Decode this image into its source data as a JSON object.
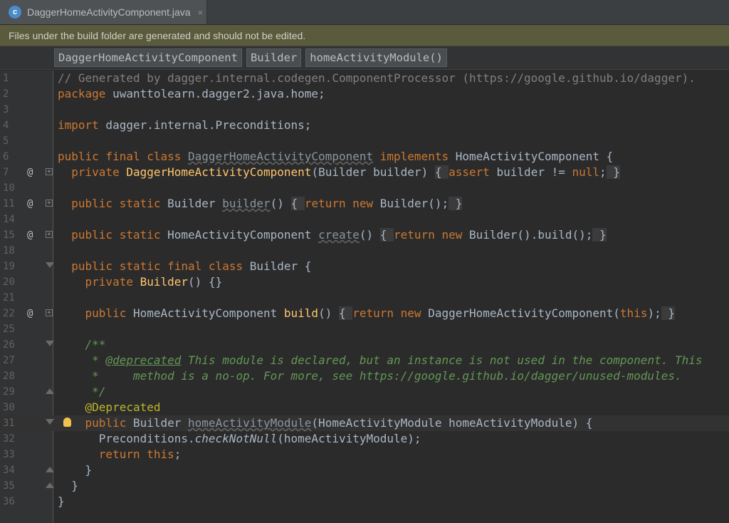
{
  "tab": {
    "title": "DaggerHomeActivityComponent.java",
    "close": "×",
    "icon_letter": "c"
  },
  "banner": {
    "text": "Files under the build folder are generated and should not be edited."
  },
  "breadcrumbs": [
    "DaggerHomeActivityComponent",
    "Builder",
    "homeActivityModule()"
  ],
  "lines": [
    {
      "n": "1",
      "code": "// Generated by dagger.internal.codegen.ComponentProcessor (https://google.github.io/dagger)."
    },
    {
      "n": "2",
      "code": "package uwanttolearn.dagger2.java.home;"
    },
    {
      "n": "3",
      "code": ""
    },
    {
      "n": "4",
      "code": "import dagger.internal.Preconditions;"
    },
    {
      "n": "5",
      "code": ""
    },
    {
      "n": "6",
      "code": "public final class DaggerHomeActivityComponent implements HomeActivityComponent {"
    },
    {
      "n": "7",
      "code": "  private DaggerHomeActivityComponent(Builder builder) { assert builder != null; }"
    },
    {
      "n": "10",
      "code": ""
    },
    {
      "n": "11",
      "code": "  public static Builder builder() { return new Builder(); }"
    },
    {
      "n": "14",
      "code": ""
    },
    {
      "n": "15",
      "code": "  public static HomeActivityComponent create() { return new Builder().build(); }"
    },
    {
      "n": "18",
      "code": ""
    },
    {
      "n": "19",
      "code": "  public static final class Builder {"
    },
    {
      "n": "20",
      "code": "    private Builder() {}"
    },
    {
      "n": "21",
      "code": ""
    },
    {
      "n": "22",
      "code": "    public HomeActivityComponent build() { return new DaggerHomeActivityComponent(this); }"
    },
    {
      "n": "25",
      "code": ""
    },
    {
      "n": "26",
      "code": "    /**"
    },
    {
      "n": "27",
      "code": "     * @deprecated This module is declared, but an instance is not used in the component. This"
    },
    {
      "n": "28",
      "code": "     *     method is a no-op. For more, see https://google.github.io/dagger/unused-modules."
    },
    {
      "n": "29",
      "code": "     */"
    },
    {
      "n": "30",
      "code": "    @Deprecated"
    },
    {
      "n": "31",
      "code": "    public Builder homeActivityModule(HomeActivityModule homeActivityModule) {"
    },
    {
      "n": "32",
      "code": "      Preconditions.checkNotNull(homeActivityModule);"
    },
    {
      "n": "33",
      "code": "      return this;"
    },
    {
      "n": "34",
      "code": "    }"
    },
    {
      "n": "35",
      "code": "  }"
    },
    {
      "n": "36",
      "code": "}"
    }
  ],
  "gutter": {
    "override_marker": "@"
  },
  "colors": {
    "keyword": "#cc7832",
    "comment": "#808080",
    "doc": "#629755",
    "annotation": "#bbb529",
    "method": "#ffc66d",
    "text": "#a9b7c6",
    "background": "#2b2b2b"
  }
}
